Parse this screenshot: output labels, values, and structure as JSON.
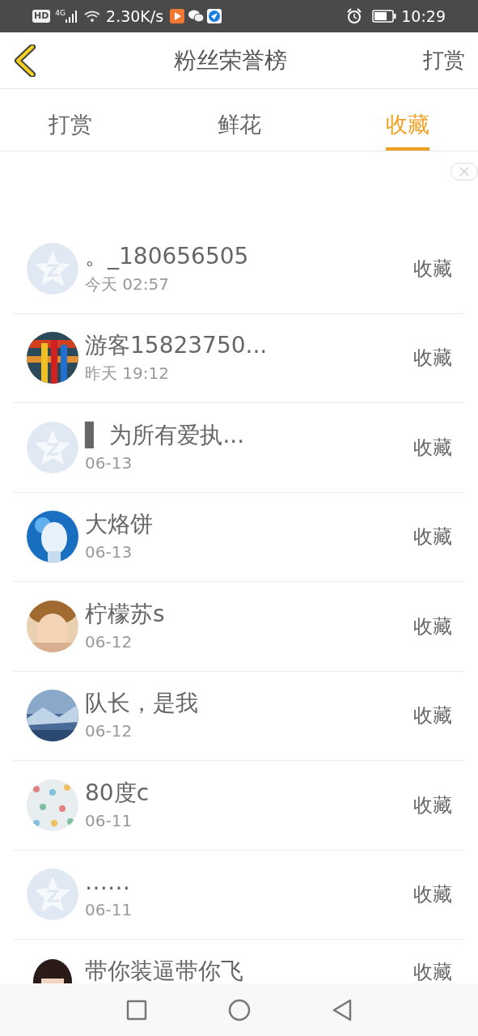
{
  "status_bar": {
    "hd": "HD",
    "network": "4G",
    "speed": "2.30K/s",
    "time": "10:29"
  },
  "header": {
    "title": "粉丝荣誉榜",
    "action": "打赏"
  },
  "tabs": [
    {
      "label": "打赏",
      "selected": false
    },
    {
      "label": "鲜花",
      "selected": false
    },
    {
      "label": "收藏",
      "selected": true
    }
  ],
  "rows": [
    {
      "name": "。_180656505",
      "date": "今天 02:57",
      "action": "收藏",
      "kind": "default"
    },
    {
      "name": "游客15823750...",
      "date": "昨天 19:12",
      "action": "收藏",
      "kind": "picture"
    },
    {
      "name": "▌ 为所有爱执...",
      "date": "06-13",
      "action": "收藏",
      "kind": "default"
    },
    {
      "name": "大烙饼",
      "date": "06-13",
      "action": "收藏",
      "kind": "picture"
    },
    {
      "name": "柠檬苏s",
      "date": "06-12",
      "action": "收藏",
      "kind": "picture"
    },
    {
      "name": "队长，是我",
      "date": "06-12",
      "action": "收藏",
      "kind": "picture"
    },
    {
      "name": "80度c",
      "date": "06-11",
      "action": "收藏",
      "kind": "picture"
    },
    {
      "name": "……",
      "date": "06-11",
      "action": "收藏",
      "kind": "default"
    },
    {
      "name": "带你装逼带你飞",
      "action": "收藏",
      "kind": "picture"
    }
  ]
}
